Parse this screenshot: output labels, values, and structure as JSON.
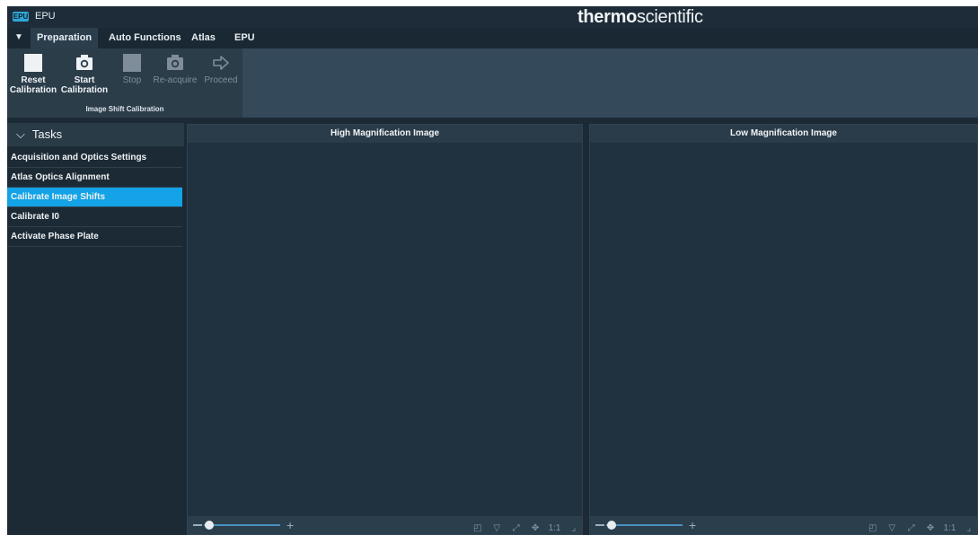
{
  "app": {
    "logo": "EPU",
    "title": "EPU"
  },
  "brand": {
    "bold": "thermo",
    "light": "scientific"
  },
  "tabs": [
    {
      "label": "Preparation",
      "active": true
    },
    {
      "label": "Auto Functions",
      "active": false
    },
    {
      "label": "Atlas",
      "active": false
    },
    {
      "label": "EPU",
      "active": false
    }
  ],
  "ribbon": {
    "group_label": "Image Shift Calibration",
    "buttons": [
      {
        "line1": "Reset",
        "line2": "Calibration",
        "icon": "square-icon",
        "enabled": true
      },
      {
        "line1": "Start",
        "line2": "Calibration",
        "icon": "camera-icon",
        "enabled": true
      },
      {
        "line1": "Stop",
        "line2": "",
        "icon": "square-icon",
        "enabled": false
      },
      {
        "line1": "Re-acquire",
        "line2": "",
        "icon": "camera-icon",
        "enabled": false
      },
      {
        "line1": "Proceed",
        "line2": "",
        "icon": "arrow-right-icon",
        "enabled": false
      }
    ]
  },
  "tasks": {
    "header": "Tasks",
    "items": [
      {
        "label": "Acquisition and Optics Settings",
        "selected": false
      },
      {
        "label": "Atlas Optics Alignment",
        "selected": false
      },
      {
        "label": "Calibrate Image Shifts",
        "selected": true
      },
      {
        "label": "Calibrate I0",
        "selected": false
      },
      {
        "label": "Activate Phase Plate",
        "selected": false
      }
    ]
  },
  "panels": {
    "high": {
      "title": "High Magnification Image"
    },
    "low": {
      "title": "Low Magnification Image"
    }
  },
  "viewer_tools": {
    "zoom_reset": "1:1",
    "icons": [
      "fit-icon",
      "filter-icon",
      "expand-icon",
      "move-icon",
      "one-to-one-icon",
      "corner-icon"
    ]
  },
  "colors": {
    "accent": "#13a3e6",
    "background": "#1c2a35"
  }
}
